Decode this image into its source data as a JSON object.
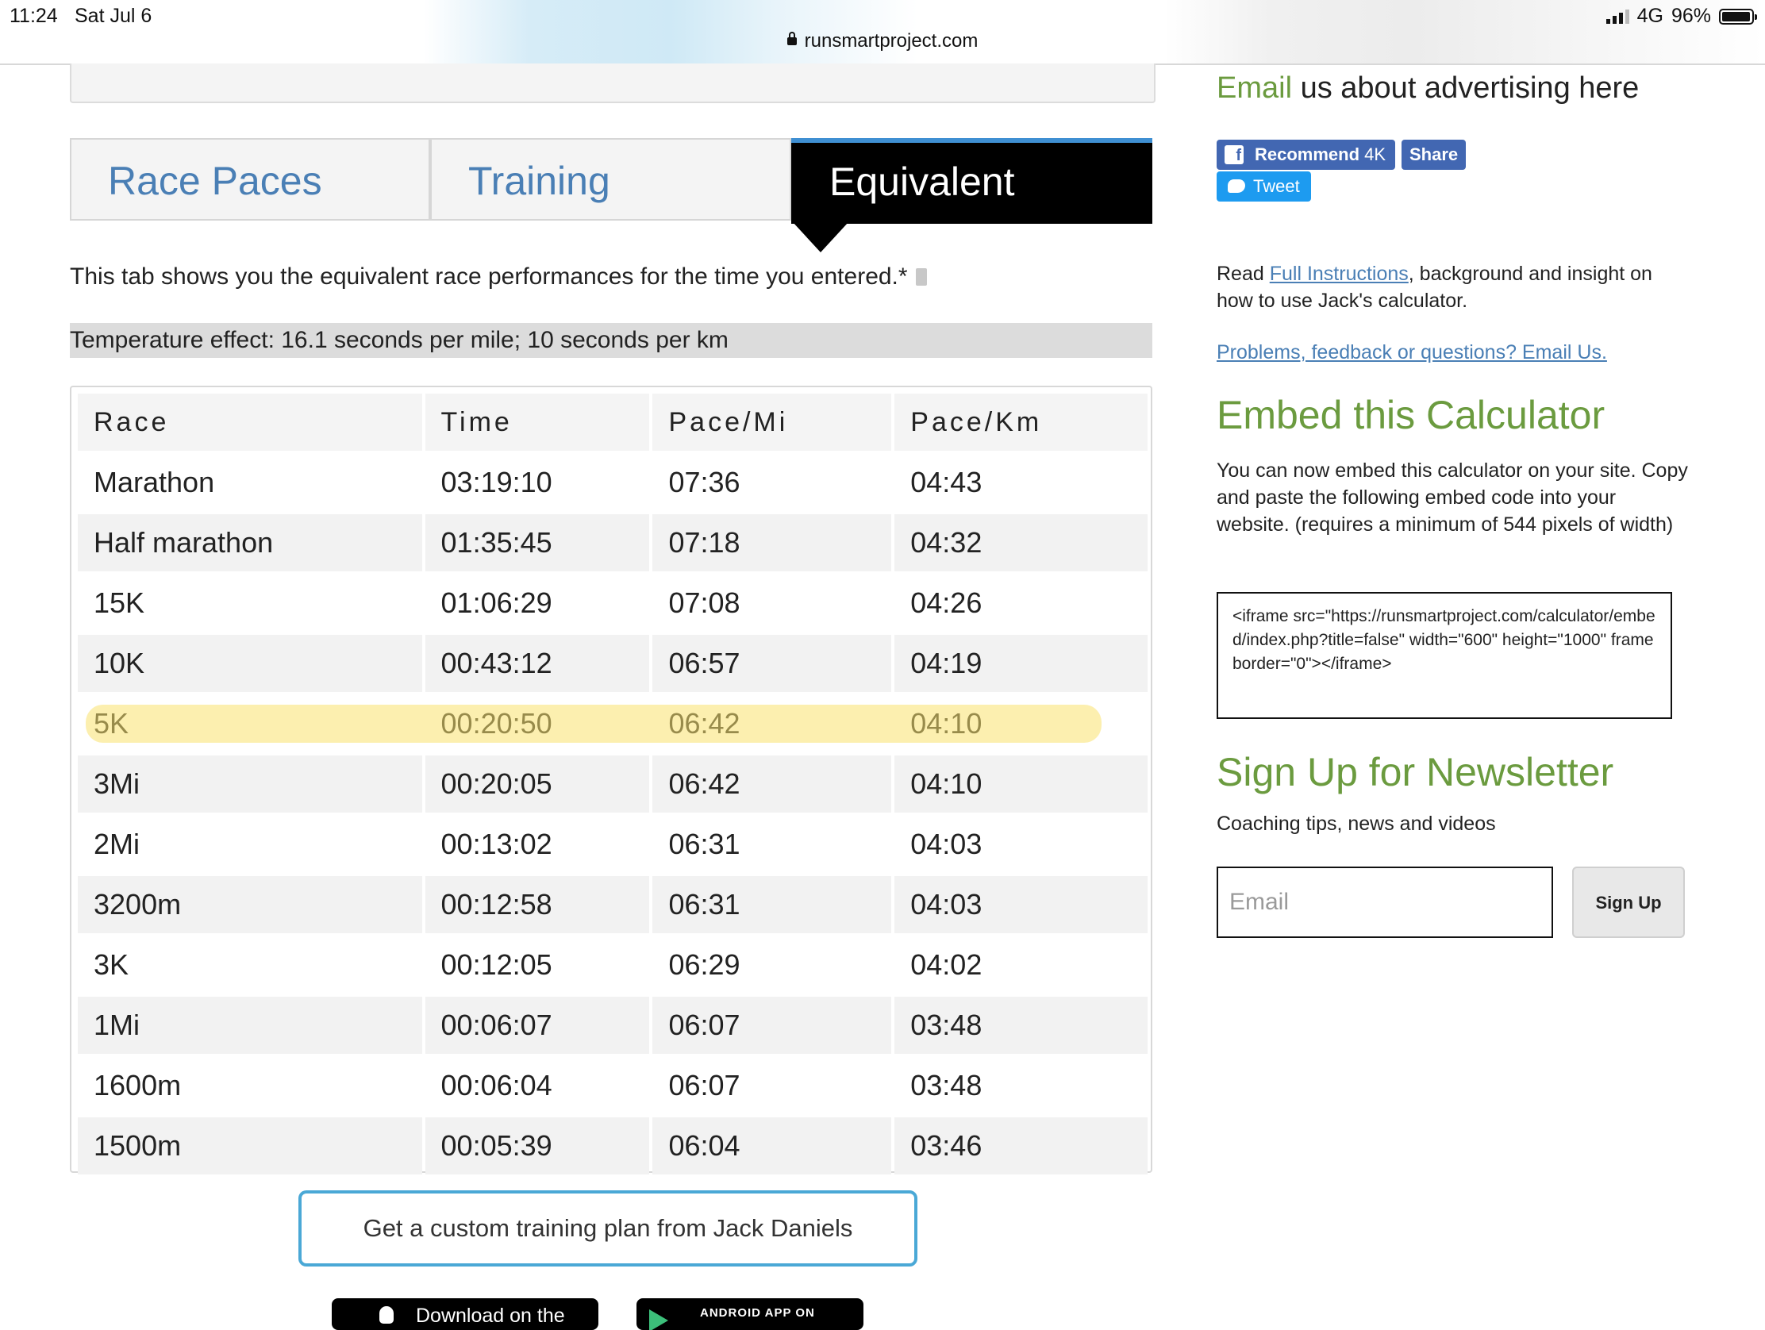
{
  "status_bar": {
    "time": "11:24",
    "date": "Sat Jul 6",
    "url": "runsmartproject.com",
    "network": "4G",
    "battery": "96%",
    "battery_level": 0.96
  },
  "tabs": [
    {
      "label": "Race Paces",
      "active": false
    },
    {
      "label": "Training",
      "active": false
    },
    {
      "label": "Equivalent",
      "active": true
    }
  ],
  "intro_text": "This tab shows you the equivalent race performances for the time you entered.*",
  "temperature_text": "Temperature effect: 16.1 seconds per mile; 10 seconds per km",
  "table": {
    "headers": [
      "Race",
      "Time",
      "Pace/Mi",
      "Pace/Km"
    ],
    "rows": [
      [
        "Marathon",
        "03:19:10",
        "07:36",
        "04:43"
      ],
      [
        "Half marathon",
        "01:35:45",
        "07:18",
        "04:32"
      ],
      [
        "15K",
        "01:06:29",
        "07:08",
        "04:26"
      ],
      [
        "10K",
        "00:43:12",
        "06:57",
        "04:19"
      ],
      [
        "5K",
        "00:20:50",
        "06:42",
        "04:10"
      ],
      [
        "3Mi",
        "00:20:05",
        "06:42",
        "04:10"
      ],
      [
        "2Mi",
        "00:13:02",
        "06:31",
        "04:03"
      ],
      [
        "3200m",
        "00:12:58",
        "06:31",
        "04:03"
      ],
      [
        "3K",
        "00:12:05",
        "06:29",
        "04:02"
      ],
      [
        "1Mi",
        "00:06:07",
        "06:07",
        "03:48"
      ],
      [
        "1600m",
        "00:06:04",
        "06:07",
        "03:48"
      ],
      [
        "1500m",
        "00:05:39",
        "06:04",
        "03:46"
      ]
    ],
    "highlighted_row": "5K"
  },
  "cta_label": "Get a custom training plan from Jack Daniels",
  "store_badges": {
    "apple": "Download on the",
    "android": "ANDROID APP ON"
  },
  "sidebar": {
    "ad_link": "Email",
    "ad_rest": " us about advertising here",
    "recommend_label": "Recommend",
    "recommend_count": "4K",
    "share_label": "Share",
    "tweet_label": "Tweet",
    "read_prefix": "Read ",
    "read_link": "Full Instructions",
    "read_suffix": ", background and insight on how to use Jack's calculator.",
    "problems_link": "Problems, feedback or questions? Email Us.",
    "embed_heading": "Embed this Calculator",
    "embed_text": "You can now embed this calculator on your site. Copy and paste the following embed code into your website. (requires a minimum of 544 pixels of width)",
    "embed_code": "<iframe src=\"https://runsmartproject.com/calculator/embed/index.php?title=false\" width=\"600\" height=\"1000\" frameborder=\"0\"></iframe>",
    "newsletter_heading": "Sign Up for Newsletter",
    "newsletter_text": "Coaching tips, news and videos",
    "email_placeholder": "Email",
    "signup_label": "Sign Up"
  },
  "colors": {
    "tab_link": "#4a7fb5",
    "active_tab_bg": "#000000",
    "heading_green": "#6b9b3f",
    "highlight": "#fae16e",
    "facebook": "#4267b2",
    "twitter": "#1d9bf0",
    "cta_border": "#4aa8d6"
  }
}
